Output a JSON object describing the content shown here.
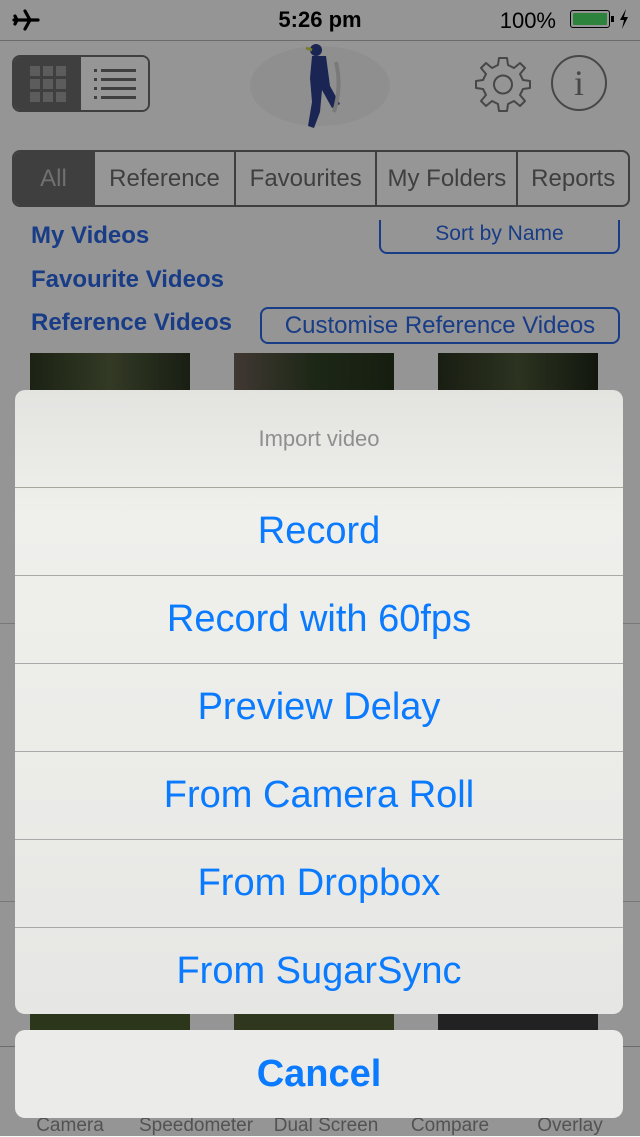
{
  "status_bar": {
    "time": "5:26 pm",
    "battery_percent": "100%",
    "battery_level": 1.0,
    "airplane_mode_icon": "airplane-icon",
    "charging_icon": "bolt-icon"
  },
  "header": {
    "view_modes": [
      {
        "name": "grid",
        "icon": "grid-icon",
        "selected": true
      },
      {
        "name": "list",
        "icon": "list-icon",
        "selected": false
      }
    ],
    "logo": "cricket-batsman-logo",
    "settings_icon": "gear-icon",
    "info_icon": "info-icon",
    "info_glyph": "i"
  },
  "filter_tabs": [
    {
      "label": "All",
      "selected": true
    },
    {
      "label": "Reference",
      "selected": false
    },
    {
      "label": "Favourites",
      "selected": false
    },
    {
      "label": "My Folders",
      "selected": false
    },
    {
      "label": "Reports",
      "selected": false
    }
  ],
  "sections": {
    "my_videos": "My Videos",
    "sort_button": "Sort by Name",
    "favourite_videos": "Favourite Videos",
    "reference_videos": "Reference Videos",
    "customise_button": "Customise Reference Videos"
  },
  "bottom_tabs": [
    "Camera",
    "Speedometer",
    "Dual Screen",
    "Compare",
    "Overlay"
  ],
  "action_sheet": {
    "title": "Import video",
    "items": [
      "Record",
      "Record with 60fps",
      "Preview Delay",
      "From Camera Roll",
      "From Dropbox",
      "From SugarSync"
    ],
    "cancel": "Cancel"
  },
  "colors": {
    "accent_blue": "#0a7aff",
    "link_blue": "#2a64e0",
    "battery_green": "#4cd964"
  }
}
